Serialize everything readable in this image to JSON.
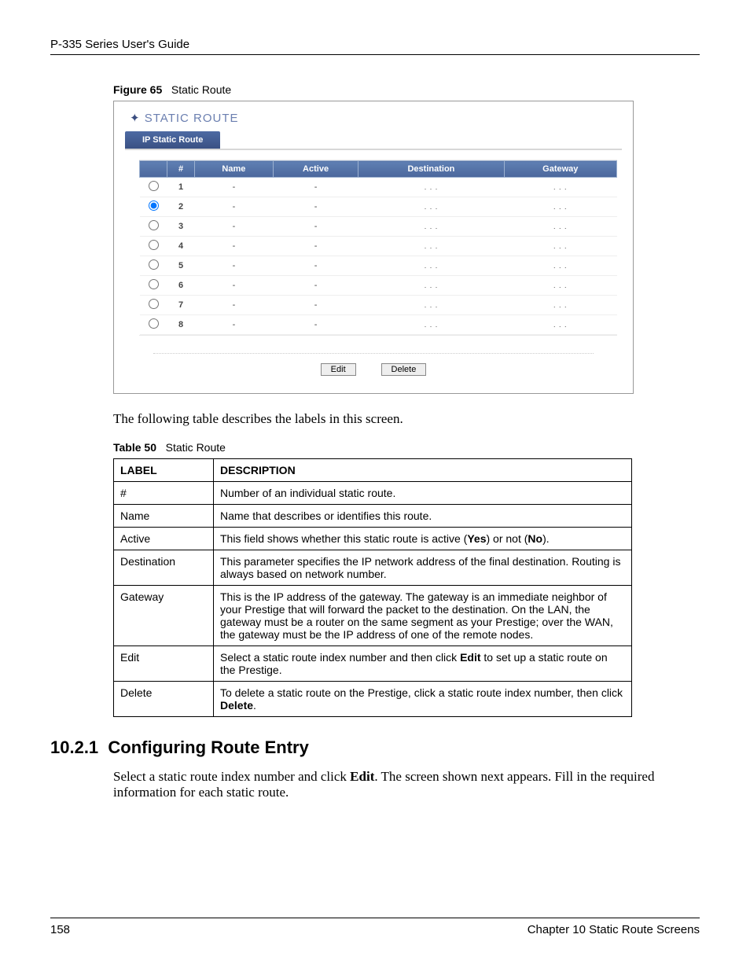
{
  "header": {
    "title": "P-335 Series User's Guide"
  },
  "figure": {
    "caption_label": "Figure 65",
    "caption_text": "Static Route",
    "panel_title": "STATIC ROUTE",
    "tab_label": "IP Static Route",
    "columns": {
      "hash": "#",
      "name": "Name",
      "active": "Active",
      "destination": "Destination",
      "gateway": "Gateway"
    },
    "rows": [
      {
        "num": "1",
        "name": "-",
        "active": "-",
        "destination": ". . .",
        "gateway": ". . .",
        "selected": false
      },
      {
        "num": "2",
        "name": "-",
        "active": "-",
        "destination": ". . .",
        "gateway": ". . .",
        "selected": true
      },
      {
        "num": "3",
        "name": "-",
        "active": "-",
        "destination": ". . .",
        "gateway": ". . .",
        "selected": false
      },
      {
        "num": "4",
        "name": "-",
        "active": "-",
        "destination": ". . .",
        "gateway": ". . .",
        "selected": false
      },
      {
        "num": "5",
        "name": "-",
        "active": "-",
        "destination": ". . .",
        "gateway": ". . .",
        "selected": false
      },
      {
        "num": "6",
        "name": "-",
        "active": "-",
        "destination": ". . .",
        "gateway": ". . .",
        "selected": false
      },
      {
        "num": "7",
        "name": "-",
        "active": "-",
        "destination": ". . .",
        "gateway": ". . .",
        "selected": false
      },
      {
        "num": "8",
        "name": "-",
        "active": "-",
        "destination": ". . .",
        "gateway": ". . .",
        "selected": false
      }
    ],
    "buttons": {
      "edit": "Edit",
      "delete": "Delete"
    }
  },
  "para1": "The following table describes the labels in this screen.",
  "table50": {
    "caption_label": "Table 50",
    "caption_text": "Static Route",
    "head_label": "LABEL",
    "head_desc": "DESCRIPTION",
    "rows": [
      {
        "label": "#",
        "desc": "Number of an individual static route."
      },
      {
        "label": "Name",
        "desc": "Name that describes or identifies this route."
      },
      {
        "label": "Active",
        "desc": "This field shows whether this static route is active (Yes) or not (No)."
      },
      {
        "label": "Destination",
        "desc": "This parameter specifies the IP network address of the final destination. Routing is always based on network number."
      },
      {
        "label": "Gateway",
        "desc": "This is the IP address of the gateway. The gateway is an immediate neighbor of your Prestige that will forward the packet to the destination. On the LAN, the gateway must be a router on the same segment as your Prestige; over the WAN, the gateway must be the IP address of one of the remote nodes."
      },
      {
        "label": "Edit",
        "desc": "Select a static route index number and then click Edit to set up a static route on the Prestige."
      },
      {
        "label": "Delete",
        "desc": "To delete a static route on the Prestige, click a static route index number, then click Delete."
      }
    ]
  },
  "section": {
    "number": "10.2.1",
    "title": "Configuring Route Entry",
    "para_a": "Select a static route index number and click ",
    "para_bold": "Edit",
    "para_b": ". The screen shown next appears. Fill in the required information for each static route."
  },
  "footer": {
    "page": "158",
    "chapter": "Chapter 10 Static Route Screens"
  }
}
